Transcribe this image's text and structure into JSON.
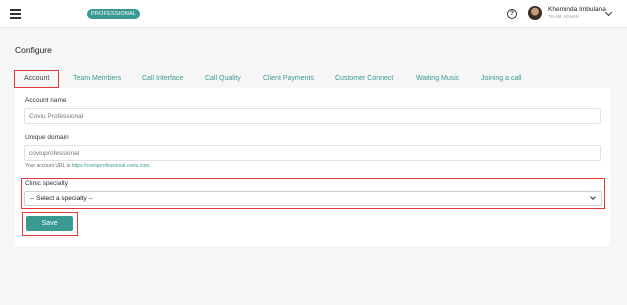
{
  "header": {
    "plan_badge": "PROFESSIONAL",
    "help_icon": "question-circle-icon",
    "user_name": "Kheminda Imbulana",
    "user_role": "TEAM ADMIN"
  },
  "page": {
    "title": "Configure"
  },
  "tabs": [
    {
      "label": "Account",
      "active": true
    },
    {
      "label": "Team Members"
    },
    {
      "label": "Call Interface"
    },
    {
      "label": "Call Quality"
    },
    {
      "label": "Client Payments"
    },
    {
      "label": "Customer Connect"
    },
    {
      "label": "Waiting Music"
    },
    {
      "label": "Joining a call"
    }
  ],
  "form": {
    "account_name_label": "Account name",
    "account_name_placeholder": "Coviu Professional",
    "unique_domain_label": "Unique domain",
    "unique_domain_placeholder": "coviuprofessional",
    "url_helper_prefix": "Your account URL is ",
    "url_helper_link": "https://coviuprofessional.coviu.com",
    "url_helper_suffix": ".",
    "specialty_label": "Clinic specialty",
    "specialty_selected": "-- Select a specialty --",
    "save_label": "Save"
  },
  "colors": {
    "accent": "#3a9a92",
    "highlight": "#e03a3a"
  }
}
